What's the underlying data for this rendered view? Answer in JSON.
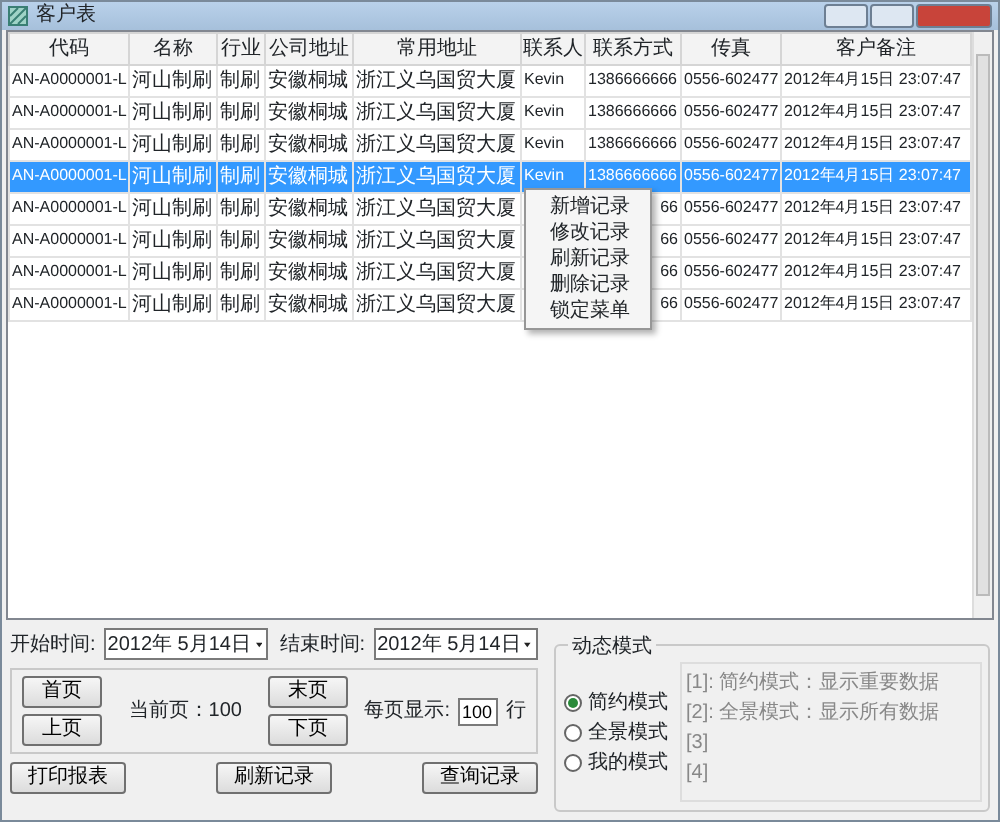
{
  "window": {
    "title": "客户表"
  },
  "table": {
    "columns": [
      "代码",
      "名称",
      "行业",
      "公司地址",
      "常用地址",
      "联系人",
      "联系方式",
      "传真",
      "客户备注"
    ],
    "rows": [
      {
        "selected": false,
        "cells": [
          "AN-A0000001-L",
          "河山制刷",
          "制刷",
          "安徽桐城",
          "浙江义乌国贸大厦",
          "Kevin",
          "1386666666",
          "0556-602477",
          "2012年4月15日 23:07:47"
        ]
      },
      {
        "selected": false,
        "cells": [
          "AN-A0000001-L",
          "河山制刷",
          "制刷",
          "安徽桐城",
          "浙江义乌国贸大厦",
          "Kevin",
          "1386666666",
          "0556-602477",
          "2012年4月15日 23:07:47"
        ]
      },
      {
        "selected": false,
        "cells": [
          "AN-A0000001-L",
          "河山制刷",
          "制刷",
          "安徽桐城",
          "浙江义乌国贸大厦",
          "Kevin",
          "1386666666",
          "0556-602477",
          "2012年4月15日 23:07:47"
        ]
      },
      {
        "selected": true,
        "cells": [
          "AN-A0000001-L",
          "河山制刷",
          "制刷",
          "安徽桐城",
          "浙江义乌国贸大厦",
          "Kevin",
          "1386666666",
          "0556-602477",
          "2012年4月15日 23:07:47"
        ]
      },
      {
        "selected": false,
        "cells": [
          "AN-A0000001-L",
          "河山制刷",
          "制刷",
          "安徽桐城",
          "浙江义乌国贸大厦",
          null,
          "66",
          "0556-602477",
          "2012年4月15日 23:07:47"
        ]
      },
      {
        "selected": false,
        "cells": [
          "AN-A0000001-L",
          "河山制刷",
          "制刷",
          "安徽桐城",
          "浙江义乌国贸大厦",
          null,
          "66",
          "0556-602477",
          "2012年4月15日 23:07:47"
        ]
      },
      {
        "selected": false,
        "cells": [
          "AN-A0000001-L",
          "河山制刷",
          "制刷",
          "安徽桐城",
          "浙江义乌国贸大厦",
          null,
          "66",
          "0556-602477",
          "2012年4月15日 23:07:47"
        ]
      },
      {
        "selected": false,
        "cells": [
          "AN-A0000001-L",
          "河山制刷",
          "制刷",
          "安徽桐城",
          "浙江义乌国贸大厦",
          null,
          "66",
          "0556-602477",
          "2012年4月15日 23:07:47"
        ]
      }
    ]
  },
  "context_menu": [
    "新增记录",
    "修改记录",
    "刷新记录",
    "删除记录",
    "锁定菜单"
  ],
  "start_time": {
    "label": "开始时间:",
    "value": "2012年 5月14日"
  },
  "end_time": {
    "label": "结束时间:",
    "value": "2012年 5月14日"
  },
  "paging": {
    "first": "首页",
    "prev": "上页",
    "current": "当前页：100",
    "last": "末页",
    "next": "下页",
    "per_page_label": "每页显示:",
    "per_page": "100",
    "unit": "行"
  },
  "buttons": [
    "打印报表",
    "刷新记录",
    "查询记录"
  ],
  "mode_group": {
    "title": "动态模式",
    "options": [
      {
        "label": "简约模式",
        "selected": true
      },
      {
        "label": "全景模式",
        "selected": false
      },
      {
        "label": "我的模式",
        "selected": false
      }
    ],
    "notes": [
      "[1]: 简约模式：显示重要数据",
      "[2]: 全景模式：显示所有数据",
      "[3]",
      "[4]"
    ]
  }
}
